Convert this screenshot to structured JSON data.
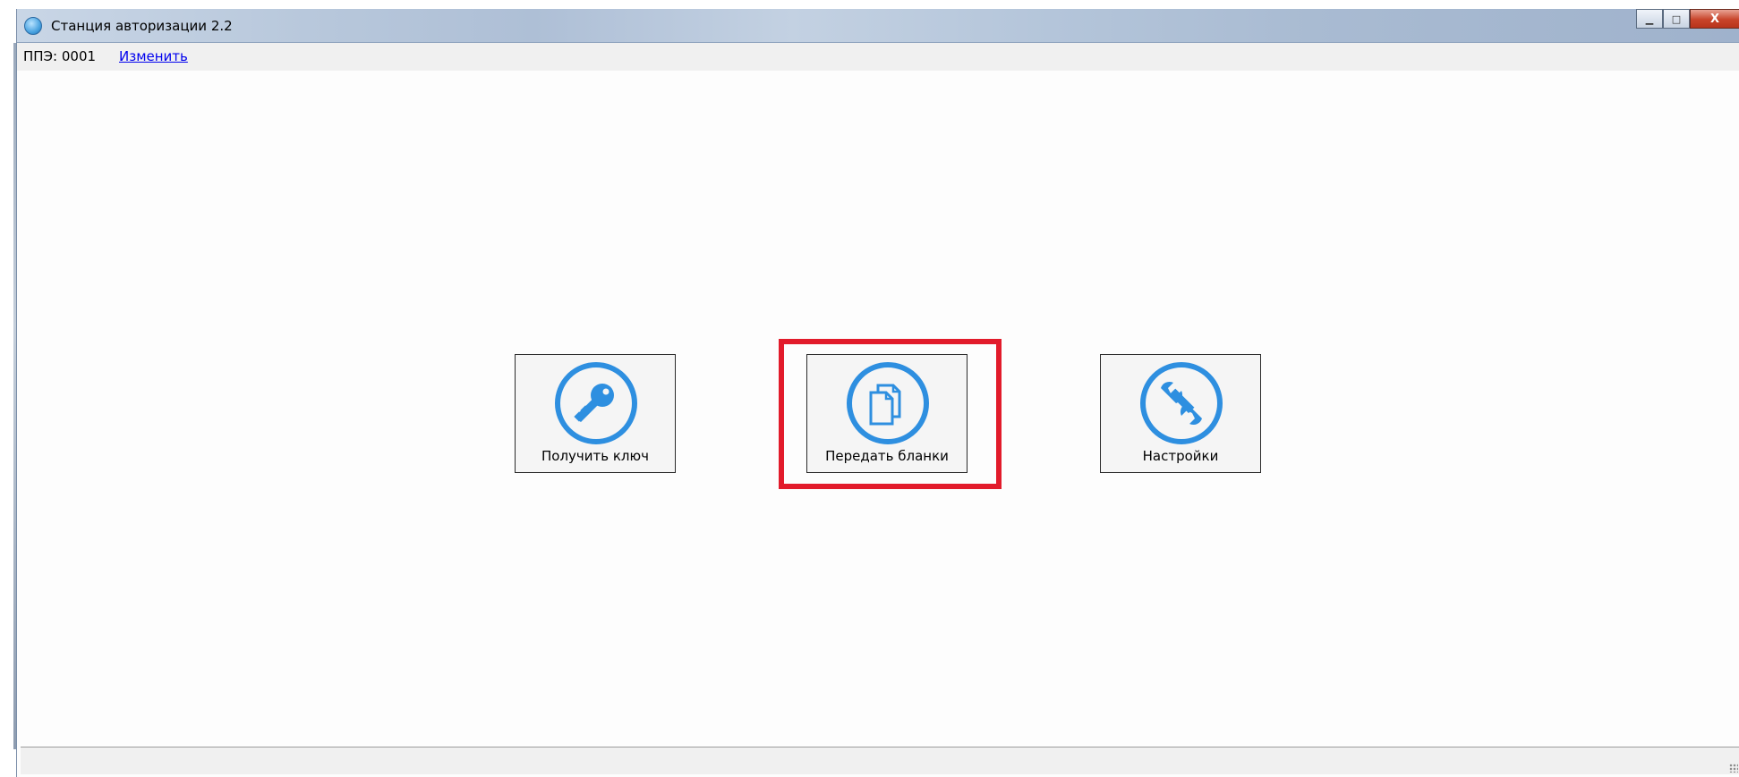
{
  "window": {
    "title": "Станция авторизации 2.2",
    "controls": {
      "minimize": "▁",
      "maximize": "□",
      "close": "X"
    }
  },
  "infobar": {
    "ppe_label": "ППЭ: 0001",
    "change_link": "Изменить"
  },
  "tiles": [
    {
      "label": "Получить ключ",
      "icon": "key-icon"
    },
    {
      "label": "Передать бланки",
      "icon": "documents-icon"
    },
    {
      "label": "Настройки",
      "icon": "wrench-icon"
    }
  ],
  "colors": {
    "icon_blue": "#2e8fe0",
    "highlight_red": "#e21b2b",
    "link_blue": "#0000ee"
  }
}
